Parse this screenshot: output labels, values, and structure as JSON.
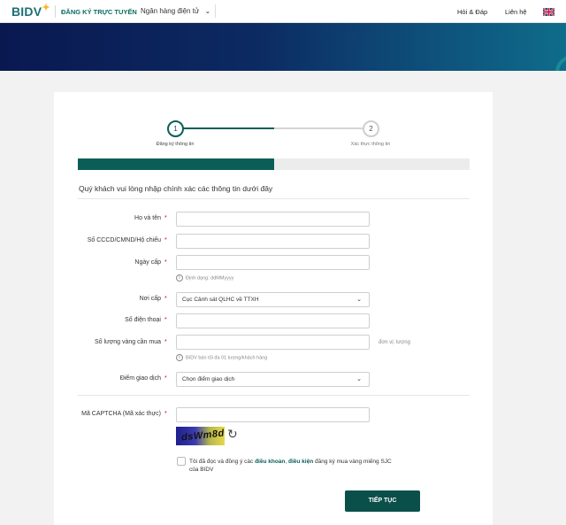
{
  "header": {
    "logo_text": "BIDV",
    "brand_sub": "ĐĂNG KÝ TRỰC TUYẾN",
    "nav_dropdown": "Ngân hàng điện tử",
    "faq": "Hỏi & Đáp",
    "contact": "Liên hệ",
    "language": "en-flag-icon"
  },
  "steps": [
    {
      "number": "1",
      "label": "Đăng ký thông tin"
    },
    {
      "number": "2",
      "label": "Xác thực thông tin"
    }
  ],
  "progress": {
    "fraction": 0.5
  },
  "form": {
    "intro": "Quý khách vui lòng nhập chính xác các thông tin dưới đây",
    "full_name": {
      "label": "Họ và tên",
      "required": "*",
      "value": ""
    },
    "id_number": {
      "label": "Số CCCD/CMND/Hộ chiếu",
      "required": "*",
      "value": ""
    },
    "issue_date": {
      "label": "Ngày cấp",
      "required": "*",
      "value": "",
      "hint": "Định dạng: ddMMyyyy"
    },
    "issue_place": {
      "label": "Nơi cấp",
      "required": "*",
      "selected": "Cục Cảnh sát QLHC về TTXH"
    },
    "phone": {
      "label": "Số điện thoại",
      "required": "*",
      "value": ""
    },
    "quantity": {
      "label": "Số lượng vàng cần mua",
      "required": "*",
      "value": "",
      "unit": "đơn vị: lượng",
      "hint": "BIDV bán tối đa 01 lượng/khách hàng"
    },
    "branch": {
      "label": "Điểm giao dịch",
      "required": "*",
      "selected": "Chọn điểm giao dịch"
    },
    "captcha": {
      "label": "Mã CAPTCHA (Mã xác thực)",
      "required": "*",
      "value": "",
      "image_text": "dsWm8d"
    },
    "terms": {
      "prefix": "Tôi đã đọc và đồng ý các ",
      "link1": "điều khoản",
      "sep": ", ",
      "link2": "điều kiện",
      "suffix": " đăng ký mua vàng miếng SJC của BIDV"
    },
    "submit": "TIẾP TỤC"
  }
}
